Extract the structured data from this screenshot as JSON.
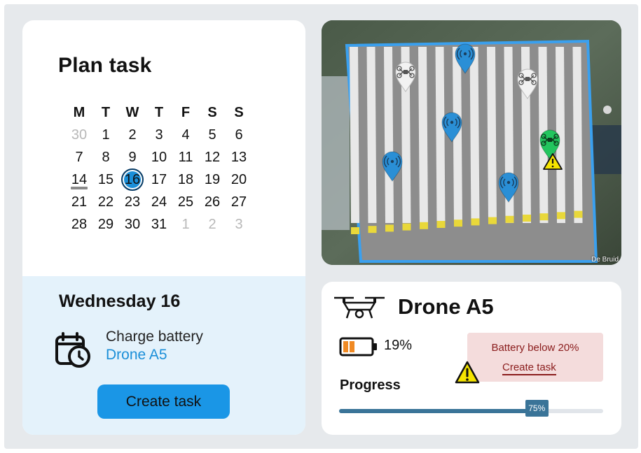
{
  "plan": {
    "title": "Plan task",
    "weekdays": [
      "M",
      "T",
      "W",
      "T",
      "F",
      "S",
      "S"
    ],
    "days": [
      {
        "n": "30",
        "muted": true
      },
      {
        "n": "1"
      },
      {
        "n": "2"
      },
      {
        "n": "3"
      },
      {
        "n": "4"
      },
      {
        "n": "5"
      },
      {
        "n": "6"
      },
      {
        "n": "7"
      },
      {
        "n": "8"
      },
      {
        "n": "9"
      },
      {
        "n": "10"
      },
      {
        "n": "11"
      },
      {
        "n": "12"
      },
      {
        "n": "13"
      },
      {
        "n": "14",
        "today": true
      },
      {
        "n": "15"
      },
      {
        "n": "16",
        "selected": true
      },
      {
        "n": "17"
      },
      {
        "n": "18"
      },
      {
        "n": "19"
      },
      {
        "n": "20"
      },
      {
        "n": "21"
      },
      {
        "n": "22"
      },
      {
        "n": "23"
      },
      {
        "n": "24"
      },
      {
        "n": "25"
      },
      {
        "n": "26"
      },
      {
        "n": "27"
      },
      {
        "n": "28"
      },
      {
        "n": "29"
      },
      {
        "n": "30"
      },
      {
        "n": "31"
      },
      {
        "n": "1",
        "muted": true
      },
      {
        "n": "2",
        "muted": true
      },
      {
        "n": "3",
        "muted": true
      }
    ]
  },
  "day": {
    "title": "Wednesday 16",
    "task_name": "Charge battery",
    "task_drone": "Drone A5",
    "create_label": "Create task"
  },
  "map": {
    "credit": "De Bruid",
    "markers": [
      {
        "kind": "idle",
        "icon": "drone-icon"
      },
      {
        "kind": "active",
        "icon": "signal-icon"
      },
      {
        "kind": "idle",
        "icon": "drone-icon"
      },
      {
        "kind": "active",
        "icon": "signal-icon"
      },
      {
        "kind": "active",
        "icon": "signal-icon"
      },
      {
        "kind": "selected",
        "icon": "drone-icon",
        "warning": true
      },
      {
        "kind": "active",
        "icon": "signal-icon"
      }
    ]
  },
  "drone": {
    "name": "Drone A5",
    "battery_pct": "19%",
    "battery_level": 0.19,
    "alert_text": "Battery below 20%",
    "alert_link": "Create task",
    "progress_label": "Progress",
    "progress": 75,
    "progress_text": "75%"
  },
  "colors": {
    "accent": "#1a96e6",
    "selected_marker": "#22c55e",
    "active_marker": "#2a8fd6",
    "alert_bg": "#f4dcdc",
    "alert_text": "#8a1c1c",
    "progress": "#3a7498",
    "battery_low": "#f08a24"
  }
}
